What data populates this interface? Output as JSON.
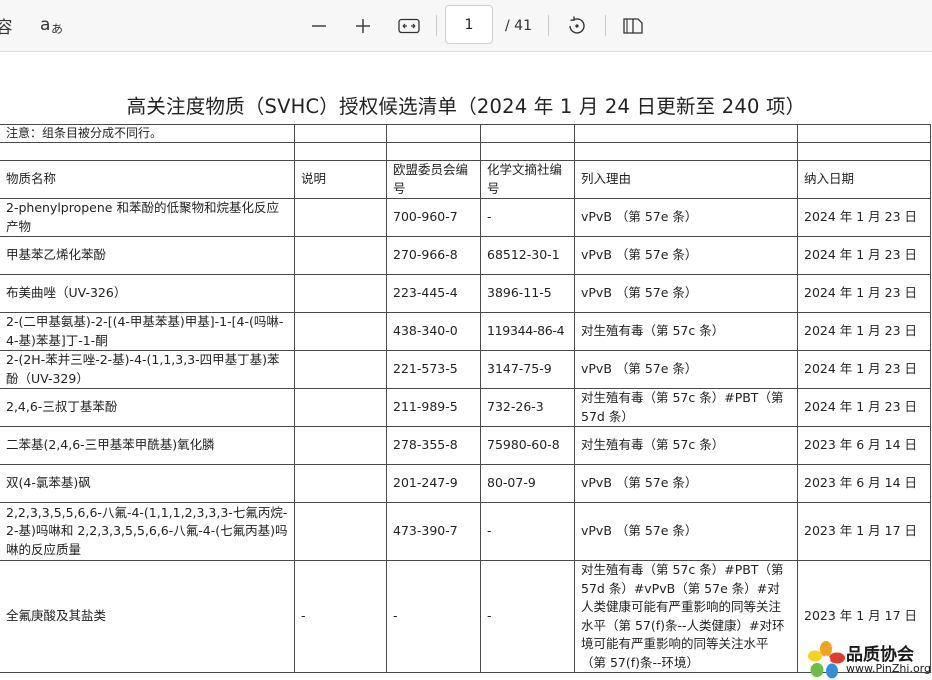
{
  "toolbar": {
    "partial_label": "容",
    "read_aloud_icon": "text-language-icon",
    "zoom_out_icon": "minus-icon",
    "zoom_in_icon": "plus-icon",
    "fit_icon": "fit-width-icon",
    "page_current": "1",
    "page_total": "/ 41",
    "rotate_icon": "rotate-icon",
    "two_page_icon": "page-view-icon"
  },
  "document": {
    "title": "高关注度物质（SVHC）授权候选清单（2024 年 1 月 24 日更新至 240 项）",
    "note": "注意：组条目被分成不同行。",
    "headers": [
      "物质名称",
      "说明",
      "欧盟委员会编号",
      "化学文摘社编号",
      "列入理由",
      "纳入日期"
    ],
    "rows": [
      {
        "name": "2-phenylpropene 和苯酚的低聚物和烷基化反应产物",
        "desc": "",
        "ec": "700-960-7",
        "cas": "-",
        "reason": "vPvB （第 57e 条）",
        "date": "2024 年 1 月 23 日"
      },
      {
        "name": "甲基苯乙烯化苯酚",
        "desc": "",
        "ec": "270-966-8",
        "cas": "68512-30-1",
        "reason": "vPvB （第 57e 条）",
        "date": "2024 年 1 月 23 日"
      },
      {
        "name": "布美曲唑（UV-326）",
        "desc": "",
        "ec": "223-445-4",
        "cas": "3896-11-5",
        "reason": "vPvB （第 57e 条）",
        "date": "2024 年 1 月 23 日"
      },
      {
        "name": "2-(二甲基氨基)-2-[(4-甲基苯基)甲基]-1-[4-(吗啉-4-基)苯基]丁-1-酮",
        "desc": "",
        "ec": "438-340-0",
        "cas": "119344-86-4",
        "reason": "对生殖有毒（第 57c 条）",
        "date": "2024 年 1 月 23 日"
      },
      {
        "name": "2-(2H-苯并三唑-2-基)-4-(1,1,3,3-四甲基丁基)苯酚（UV-329）",
        "desc": "",
        "ec": "221-573-5",
        "cas": "3147-75-9",
        "reason": "vPvB （第 57e 条）",
        "date": "2024 年 1 月 23 日"
      },
      {
        "name": "2,4,6-三叔丁基苯酚",
        "desc": "",
        "ec": "211-989-5",
        "cas": "732-26-3",
        "reason": "对生殖有毒（第 57c 条）#PBT（第 57d 条）",
        "date": "2024 年 1 月 23 日"
      },
      {
        "name": "二苯基(2,4,6-三甲基苯甲酰基)氧化膦",
        "desc": "",
        "ec": "278-355-8",
        "cas": "75980-60-8",
        "reason": "对生殖有毒（第 57c 条）",
        "date": "2023 年 6 月 14 日"
      },
      {
        "name": "双(4-氯苯基)砜",
        "desc": "",
        "ec": "201-247-9",
        "cas": "80-07-9",
        "reason": "vPvB （第 57e 条）",
        "date": "2023 年 6 月 14 日"
      },
      {
        "name": "2,2,3,3,5,5,6,6-八氟-4-(1,1,1,2,3,3,3-七氟丙烷-2-基)吗啉和 2,2,3,3,5,5,6,6-八氟-4-(七氟丙基)吗啉的反应质量",
        "desc": "",
        "ec": "473-390-7",
        "cas": "-",
        "reason": "vPvB （第 57e 条）",
        "date": "2023 年 1 月 17 日"
      },
      {
        "name": "全氟庚酸及其盐类",
        "desc": "-",
        "ec": "-",
        "cas": "-",
        "reason": "对生殖有毒（第 57c 条）#PBT（第 57d 条）#vPvB（第 57e 条）#对人类健康可能有严重影响的同等关注水平（第 57(f)条--人类健康）#对环境可能有严重影响的同等关注水平（第 57(f)条--环境）",
        "date": "2023 年 1 月 17 日"
      }
    ]
  },
  "watermark": {
    "title": "品质协会",
    "url": "www.PinZhi.org"
  }
}
